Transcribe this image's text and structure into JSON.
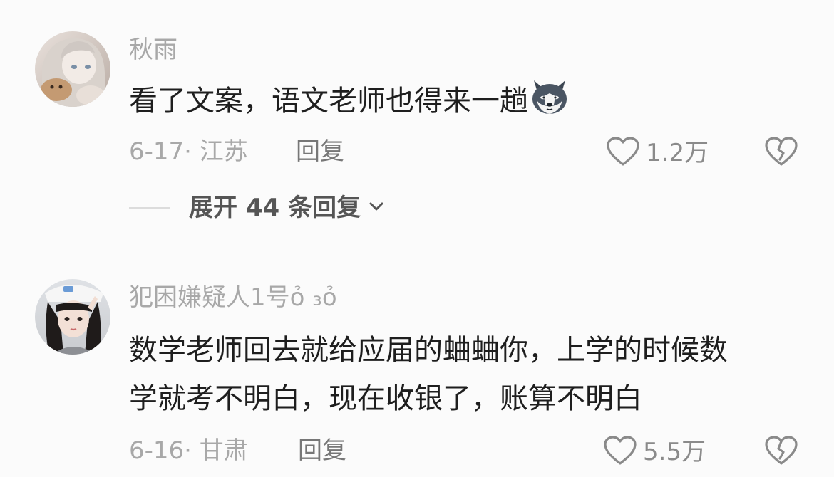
{
  "comments": [
    {
      "username": "秋雨",
      "text": "看了文案，语文老师也得来一趟",
      "emoji": "husky-emoji",
      "date_location": "6-17· 江苏",
      "reply_label": "回复",
      "likes": "1.2万",
      "expand_label": "展开 44 条回复"
    },
    {
      "username": "犯困嫌疑人1号ỏ ₃ỏ",
      "text_line1": "数学老师回去就给应届的蛐蛐你，上学的时候数",
      "text_line2": "学就考不明白，现在收银了，账算不明白",
      "date_location": "6-16· 甘肃",
      "reply_label": "回复",
      "likes": "5.5万"
    }
  ],
  "colors": {
    "background": "#fbfbfb",
    "text_primary": "#1e1e1e",
    "text_secondary": "#a8a8a8",
    "icon": "#8a8a8a"
  }
}
